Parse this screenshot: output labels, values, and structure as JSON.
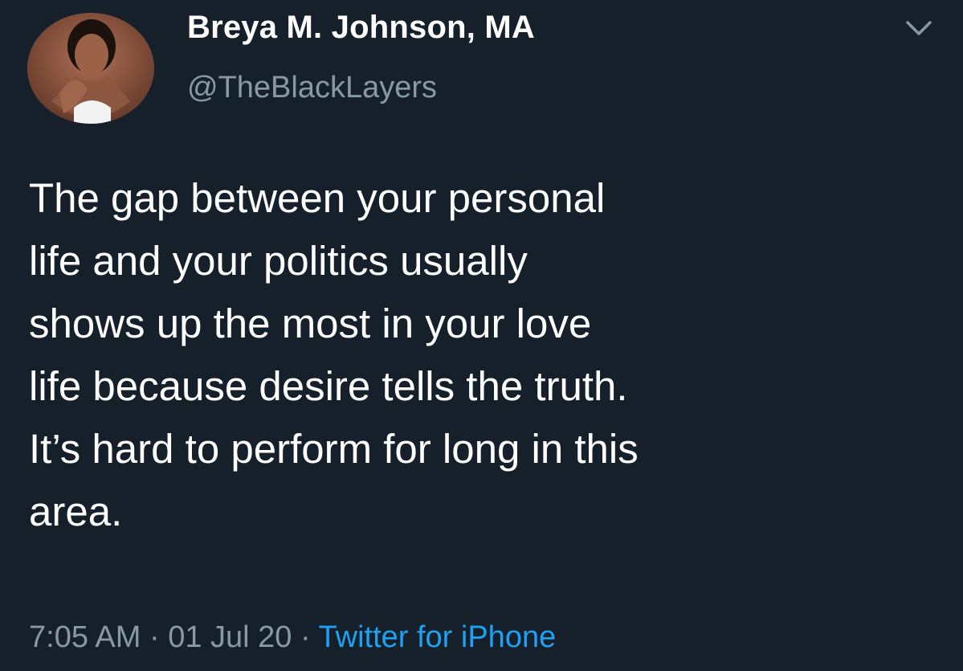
{
  "tweet": {
    "author": {
      "display_name": "Breya M. Johnson, MA",
      "handle": "@TheBlackLayers",
      "avatar_icon": "profile-photo"
    },
    "menu_icon": "chevron-down-icon",
    "text": "The gap between your personal\nlife and your politics usually\nshows up the most in your love\nlife because desire tells the truth.\nIt’s hard to perform for long in this\narea.",
    "time": "7:05 AM",
    "separator": "·",
    "date": "01 Jul 20",
    "source": "Twitter for iPhone"
  },
  "colors": {
    "background": "#15202b",
    "primary_text": "#ffffff",
    "secondary_text": "#8899a6",
    "link": "#1da1f2"
  }
}
